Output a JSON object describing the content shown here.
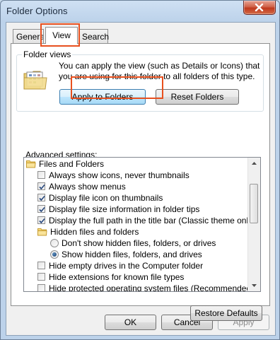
{
  "window": {
    "title": "Folder Options"
  },
  "tabs": [
    {
      "label": "General"
    },
    {
      "label": "View"
    },
    {
      "label": "Search"
    }
  ],
  "folder_views": {
    "legend": "Folder views",
    "description": "You can apply the view (such as Details or Icons) that you are using for this folder to all folders of this type.",
    "apply_button": "Apply to Folders",
    "reset_button": "Reset Folders"
  },
  "advanced": {
    "label": "Advanced settings:",
    "items": [
      {
        "type": "folder",
        "label": "Files and Folders",
        "indent": 0
      },
      {
        "type": "checkbox",
        "label": "Always show icons, never thumbnails",
        "checked": false,
        "indent": 1
      },
      {
        "type": "checkbox",
        "label": "Always show menus",
        "checked": true,
        "indent": 1
      },
      {
        "type": "checkbox",
        "label": "Display file icon on thumbnails",
        "checked": true,
        "indent": 1
      },
      {
        "type": "checkbox",
        "label": "Display file size information in folder tips",
        "checked": true,
        "indent": 1
      },
      {
        "type": "checkbox",
        "label": "Display the full path in the title bar (Classic theme only)",
        "checked": true,
        "indent": 1
      },
      {
        "type": "folder",
        "label": "Hidden files and folders",
        "indent": 1
      },
      {
        "type": "radio",
        "label": "Don't show hidden files, folders, or drives",
        "checked": false,
        "indent": 2
      },
      {
        "type": "radio",
        "label": "Show hidden files, folders, and drives",
        "checked": true,
        "indent": 2
      },
      {
        "type": "checkbox",
        "label": "Hide empty drives in the Computer folder",
        "checked": false,
        "indent": 1
      },
      {
        "type": "checkbox",
        "label": "Hide extensions for known file types",
        "checked": false,
        "indent": 1
      },
      {
        "type": "checkbox",
        "label": "Hide protected operating system files (Recommended)",
        "checked": false,
        "indent": 1
      }
    ],
    "restore_button": "Restore Defaults"
  },
  "footer": {
    "ok": "OK",
    "cancel": "Cancel",
    "apply": "Apply"
  }
}
